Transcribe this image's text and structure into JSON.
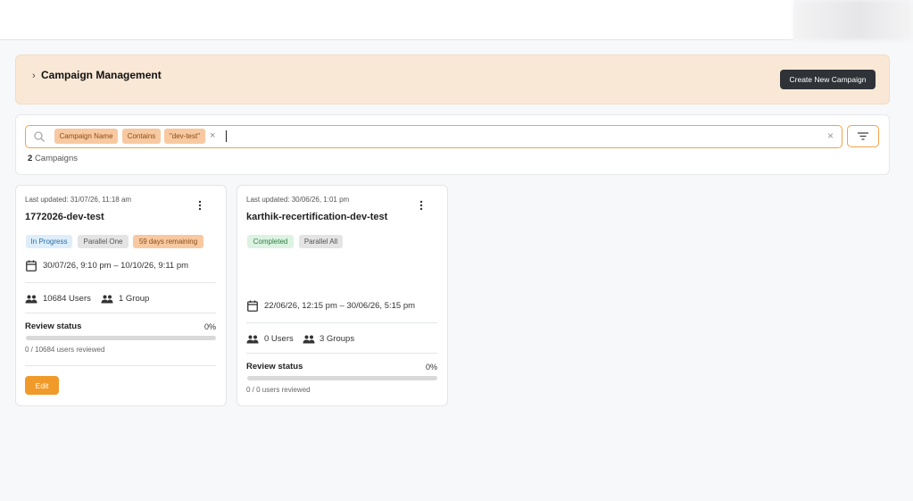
{
  "header": {
    "title": "Campaign Management",
    "chevron_icon": "chevron-right-icon",
    "create_button_label": "Create New Campaign"
  },
  "search": {
    "icon": "search-icon",
    "chips": [
      "Campaign Name",
      "Contains",
      "\"dev-test\""
    ],
    "chip_remove": "×",
    "clear": "×",
    "value": "",
    "filter_icon": "filter-icon"
  },
  "results": {
    "count": "2",
    "label": "Campaigns"
  },
  "colors": {
    "accent": "#f09a2a",
    "banner_bg": "#fae8d6",
    "dark_button": "#2f3338"
  },
  "campaigns": [
    {
      "updated": "Last updated: 31/07/26, 11:18 am",
      "name": "1772026-dev-test",
      "badges": [
        "In Progress",
        "Parallel One",
        "59 days remaining"
      ],
      "date_range": "30/07/26, 9:10 pm – 10/10/26, 9:11 pm",
      "users": "10684 Users",
      "groups": "1 Group",
      "review_label": "Review status",
      "review_percent": "0%",
      "progress": 0,
      "reviewed": "0 / 10684 users reviewed",
      "edit_label": "Edit"
    },
    {
      "updated": "Last updated: 30/06/26, 1:01 pm",
      "name": "karthik-recertification-dev-test",
      "badges": [
        "Completed",
        "Parallel All"
      ],
      "date_range": "22/06/26, 12:15 pm – 30/06/26, 5:15 pm",
      "users": "0 Users",
      "groups": "3 Groups",
      "review_label": "Review status",
      "review_percent": "0%",
      "progress": 0,
      "reviewed": "0 / 0 users reviewed"
    }
  ]
}
